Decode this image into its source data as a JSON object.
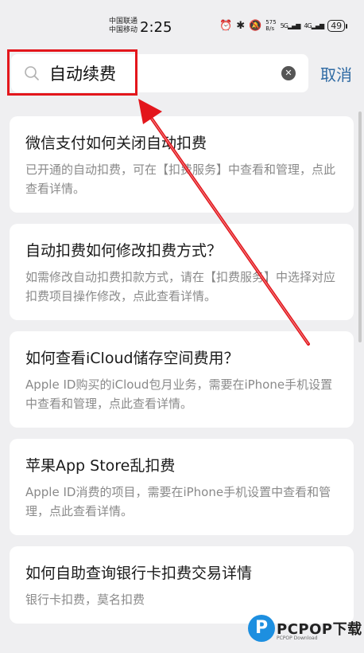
{
  "status_bar": {
    "carrier_1": "中国联通",
    "carrier_2": "中国移动",
    "time": "2:25",
    "net_speed_value": "575",
    "net_speed_unit": "B/s",
    "network_1": "5G",
    "network_2": "4G",
    "battery": "49"
  },
  "search": {
    "query": "自动续费",
    "cancel_label": "取消"
  },
  "results": [
    {
      "title": "微信支付如何关闭自动扣费",
      "desc": "已开通的自动扣费，可在【扣费服务】中查看和管理，点此查看详情。"
    },
    {
      "title": "自动扣费如何修改扣费方式？",
      "desc": "如需修改自动扣费扣款方式，请在【扣费服务】中选择对应扣费项目操作修改，点此查看详情。"
    },
    {
      "title": "如何查看iCloud储存空间费用？",
      "desc": "Apple ID购买的iCloud包月业务，需要在iPhone手机设置中查看和管理，点此查看详情。"
    },
    {
      "title": "苹果App Store乱扣费",
      "desc": "Apple ID消费的项目，需要在iPhone手机设置中查看和管理，点此查看详情。"
    },
    {
      "title": "如何自助查询银行卡扣费交易详情",
      "desc": "银行卡扣费，莫名扣费"
    }
  ],
  "watermark": {
    "logo_letter": "P",
    "brand": "PCPOP下载",
    "sub": "PCPOP Download"
  },
  "colors": {
    "accent": "#2f6aa3",
    "annotation": "#e3161c",
    "background": "#efeff1"
  }
}
